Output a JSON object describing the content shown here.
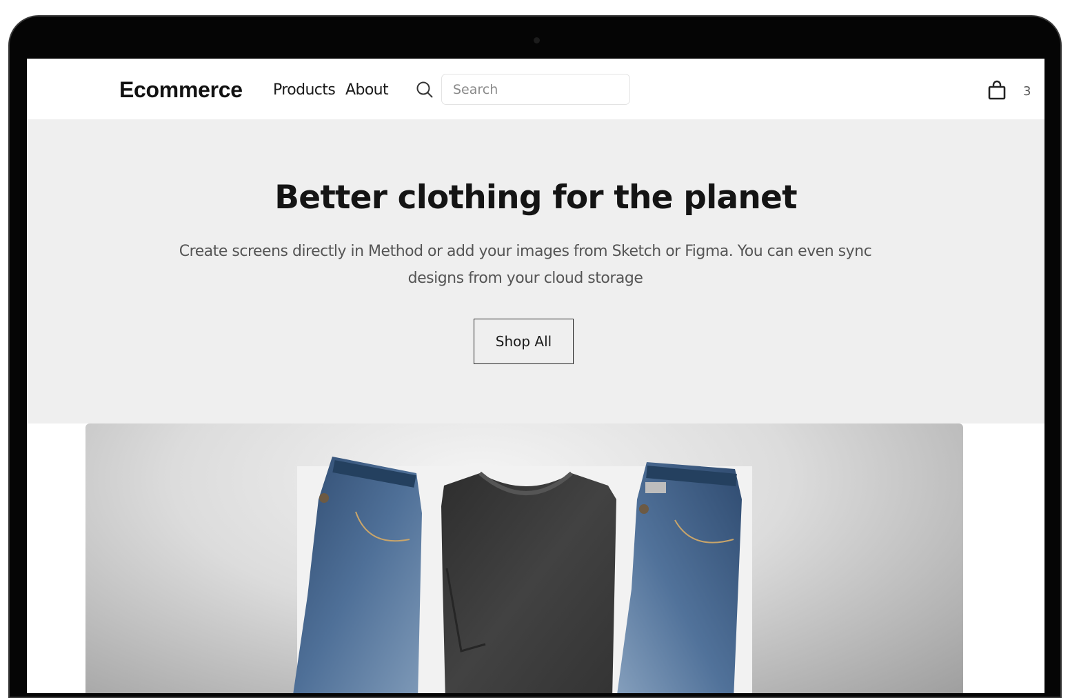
{
  "header": {
    "brand": "Ecommerce",
    "nav": [
      {
        "label": "Products"
      },
      {
        "label": "About"
      }
    ],
    "search": {
      "placeholder": "Search",
      "value": "",
      "icon": "search-icon"
    },
    "cart": {
      "icon": "shopping-bag-icon",
      "count": "3"
    }
  },
  "hero": {
    "title": "Better clothing for the planet",
    "subtitle": "Create screens directly in Method or add your images from Sketch or Figma. You can even sync designs from your cloud storage",
    "cta_label": "Shop All",
    "background": "#efefef"
  },
  "colors": {
    "text_primary": "#141414",
    "text_secondary": "#555555",
    "denim": "#3f5f86",
    "tshirt": "#3a3a3a"
  }
}
